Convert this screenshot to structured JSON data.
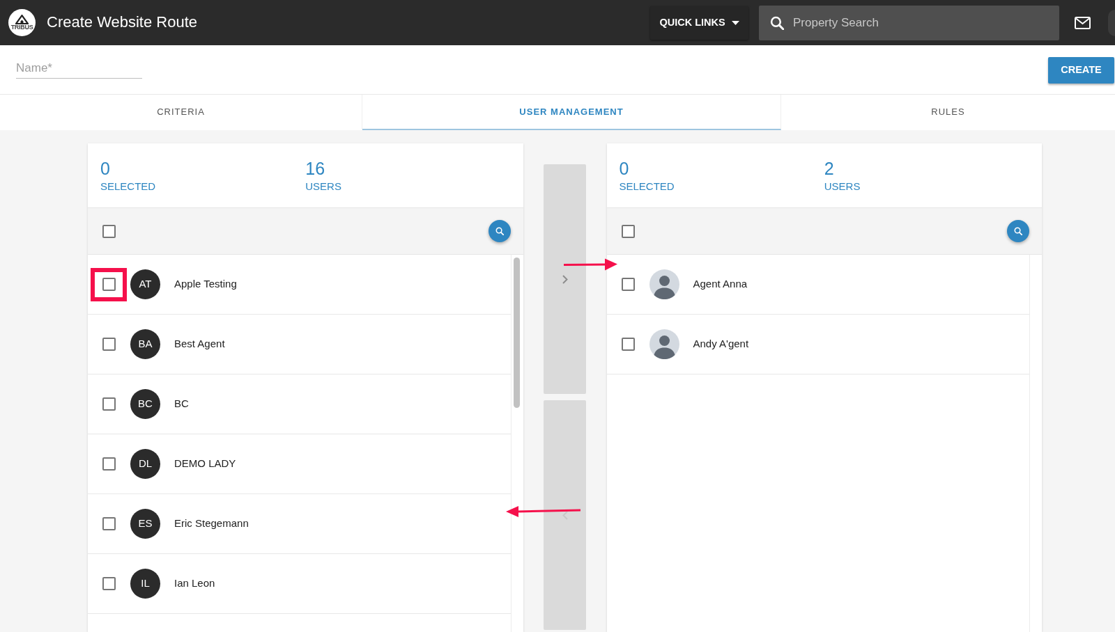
{
  "app_bar": {
    "logo_text": "TRIBUS",
    "title": "Create Website Route",
    "quick_links": "QUICK LINKS",
    "search": {
      "placeholder": "Property Search"
    }
  },
  "form": {
    "name_field": {
      "placeholder": "Name*"
    },
    "create_button": "CREATE"
  },
  "tabs": [
    {
      "label": "CRITERIA",
      "selected": false
    },
    {
      "label": "USER MANAGEMENT",
      "selected": true
    },
    {
      "label": "RULES",
      "selected": false
    }
  ],
  "user_lists": [
    {
      "stats": [
        {
          "value": "0",
          "label": "SELECTED"
        },
        {
          "value": "16",
          "label": "USERS"
        }
      ],
      "select_all": {
        "checked": false
      },
      "rows": [
        {
          "kind": "initials",
          "initials": "AT",
          "name": "Apple Testing",
          "checked": false
        },
        {
          "kind": "initials",
          "initials": "BA",
          "name": "Best Agent",
          "checked": false
        },
        {
          "kind": "initials",
          "initials": "BC",
          "name": "BC",
          "checked": false
        },
        {
          "kind": "initials",
          "initials": "DL",
          "name": "DEMO LADY",
          "checked": false
        },
        {
          "kind": "initials",
          "initials": "ES",
          "name": "Eric Stegemann",
          "checked": false
        },
        {
          "kind": "initials",
          "initials": "IL",
          "name": "Ian Leon",
          "checked": false
        }
      ]
    },
    {
      "stats": [
        {
          "value": "0",
          "label": "SELECTED"
        },
        {
          "value": "2",
          "label": "USERS"
        }
      ],
      "select_all": {
        "checked": false
      },
      "rows": [
        {
          "kind": "photo",
          "name": "Agent Anna",
          "checked": false
        },
        {
          "kind": "photo",
          "name": "Andy A'gent",
          "checked": false
        }
      ]
    }
  ],
  "transfer_buttons": [
    {
      "kind": "move_right",
      "disabled": false
    },
    {
      "kind": "move_left",
      "disabled": true
    }
  ],
  "annotations": [
    {
      "kind": "frame"
    },
    {
      "kind": "arrow_right"
    },
    {
      "kind": "arrow_left"
    }
  ]
}
